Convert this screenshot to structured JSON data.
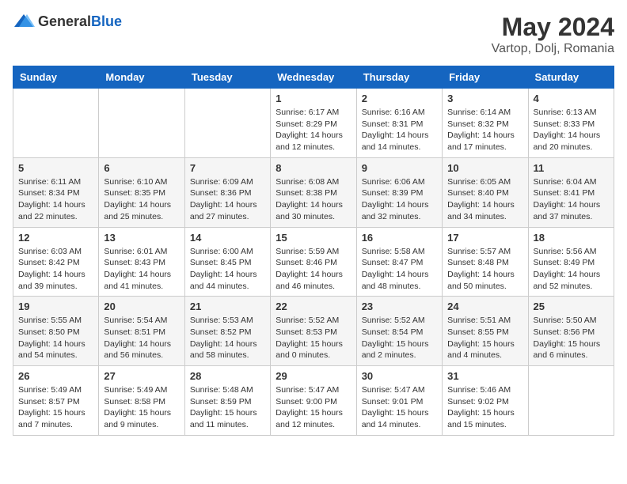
{
  "header": {
    "logo_general": "General",
    "logo_blue": "Blue",
    "title": "May 2024",
    "location": "Vartop, Dolj, Romania"
  },
  "weekdays": [
    "Sunday",
    "Monday",
    "Tuesday",
    "Wednesday",
    "Thursday",
    "Friday",
    "Saturday"
  ],
  "weeks": [
    [
      {
        "day": "",
        "info": ""
      },
      {
        "day": "",
        "info": ""
      },
      {
        "day": "",
        "info": ""
      },
      {
        "day": "1",
        "info": "Sunrise: 6:17 AM\nSunset: 8:29 PM\nDaylight: 14 hours\nand 12 minutes."
      },
      {
        "day": "2",
        "info": "Sunrise: 6:16 AM\nSunset: 8:31 PM\nDaylight: 14 hours\nand 14 minutes."
      },
      {
        "day": "3",
        "info": "Sunrise: 6:14 AM\nSunset: 8:32 PM\nDaylight: 14 hours\nand 17 minutes."
      },
      {
        "day": "4",
        "info": "Sunrise: 6:13 AM\nSunset: 8:33 PM\nDaylight: 14 hours\nand 20 minutes."
      }
    ],
    [
      {
        "day": "5",
        "info": "Sunrise: 6:11 AM\nSunset: 8:34 PM\nDaylight: 14 hours\nand 22 minutes."
      },
      {
        "day": "6",
        "info": "Sunrise: 6:10 AM\nSunset: 8:35 PM\nDaylight: 14 hours\nand 25 minutes."
      },
      {
        "day": "7",
        "info": "Sunrise: 6:09 AM\nSunset: 8:36 PM\nDaylight: 14 hours\nand 27 minutes."
      },
      {
        "day": "8",
        "info": "Sunrise: 6:08 AM\nSunset: 8:38 PM\nDaylight: 14 hours\nand 30 minutes."
      },
      {
        "day": "9",
        "info": "Sunrise: 6:06 AM\nSunset: 8:39 PM\nDaylight: 14 hours\nand 32 minutes."
      },
      {
        "day": "10",
        "info": "Sunrise: 6:05 AM\nSunset: 8:40 PM\nDaylight: 14 hours\nand 34 minutes."
      },
      {
        "day": "11",
        "info": "Sunrise: 6:04 AM\nSunset: 8:41 PM\nDaylight: 14 hours\nand 37 minutes."
      }
    ],
    [
      {
        "day": "12",
        "info": "Sunrise: 6:03 AM\nSunset: 8:42 PM\nDaylight: 14 hours\nand 39 minutes."
      },
      {
        "day": "13",
        "info": "Sunrise: 6:01 AM\nSunset: 8:43 PM\nDaylight: 14 hours\nand 41 minutes."
      },
      {
        "day": "14",
        "info": "Sunrise: 6:00 AM\nSunset: 8:45 PM\nDaylight: 14 hours\nand 44 minutes."
      },
      {
        "day": "15",
        "info": "Sunrise: 5:59 AM\nSunset: 8:46 PM\nDaylight: 14 hours\nand 46 minutes."
      },
      {
        "day": "16",
        "info": "Sunrise: 5:58 AM\nSunset: 8:47 PM\nDaylight: 14 hours\nand 48 minutes."
      },
      {
        "day": "17",
        "info": "Sunrise: 5:57 AM\nSunset: 8:48 PM\nDaylight: 14 hours\nand 50 minutes."
      },
      {
        "day": "18",
        "info": "Sunrise: 5:56 AM\nSunset: 8:49 PM\nDaylight: 14 hours\nand 52 minutes."
      }
    ],
    [
      {
        "day": "19",
        "info": "Sunrise: 5:55 AM\nSunset: 8:50 PM\nDaylight: 14 hours\nand 54 minutes."
      },
      {
        "day": "20",
        "info": "Sunrise: 5:54 AM\nSunset: 8:51 PM\nDaylight: 14 hours\nand 56 minutes."
      },
      {
        "day": "21",
        "info": "Sunrise: 5:53 AM\nSunset: 8:52 PM\nDaylight: 14 hours\nand 58 minutes."
      },
      {
        "day": "22",
        "info": "Sunrise: 5:52 AM\nSunset: 8:53 PM\nDaylight: 15 hours\nand 0 minutes."
      },
      {
        "day": "23",
        "info": "Sunrise: 5:52 AM\nSunset: 8:54 PM\nDaylight: 15 hours\nand 2 minutes."
      },
      {
        "day": "24",
        "info": "Sunrise: 5:51 AM\nSunset: 8:55 PM\nDaylight: 15 hours\nand 4 minutes."
      },
      {
        "day": "25",
        "info": "Sunrise: 5:50 AM\nSunset: 8:56 PM\nDaylight: 15 hours\nand 6 minutes."
      }
    ],
    [
      {
        "day": "26",
        "info": "Sunrise: 5:49 AM\nSunset: 8:57 PM\nDaylight: 15 hours\nand 7 minutes."
      },
      {
        "day": "27",
        "info": "Sunrise: 5:49 AM\nSunset: 8:58 PM\nDaylight: 15 hours\nand 9 minutes."
      },
      {
        "day": "28",
        "info": "Sunrise: 5:48 AM\nSunset: 8:59 PM\nDaylight: 15 hours\nand 11 minutes."
      },
      {
        "day": "29",
        "info": "Sunrise: 5:47 AM\nSunset: 9:00 PM\nDaylight: 15 hours\nand 12 minutes."
      },
      {
        "day": "30",
        "info": "Sunrise: 5:47 AM\nSunset: 9:01 PM\nDaylight: 15 hours\nand 14 minutes."
      },
      {
        "day": "31",
        "info": "Sunrise: 5:46 AM\nSunset: 9:02 PM\nDaylight: 15 hours\nand 15 minutes."
      },
      {
        "day": "",
        "info": ""
      }
    ]
  ]
}
